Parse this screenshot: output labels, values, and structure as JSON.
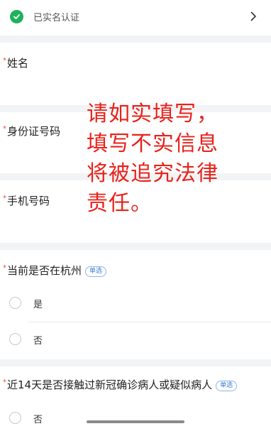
{
  "verification": {
    "label": "已实名认证"
  },
  "fields": {
    "name": {
      "label": "姓名",
      "required_mark": "*"
    },
    "id_number": {
      "label": "身份证号码",
      "required_mark": "*"
    },
    "phone": {
      "label": "手机号码",
      "required_mark": "*"
    }
  },
  "questions": [
    {
      "required_mark": "*",
      "label": "当前是否在杭州",
      "tag": "单选",
      "options": [
        "是",
        "否"
      ]
    },
    {
      "required_mark": "*",
      "label": "近14天是否接触过新冠确诊病人或疑似病人",
      "tag": "单选",
      "options": [
        "否"
      ]
    }
  ],
  "overlay_notice": {
    "line1": "请如实填写，",
    "line2": "填写不实信息",
    "line3": "将被追究法律",
    "line4": "责任。"
  },
  "colors": {
    "accent_green": "#1fb25a",
    "warning_red": "#e8221b",
    "tag_blue": "#3a7bd5"
  }
}
